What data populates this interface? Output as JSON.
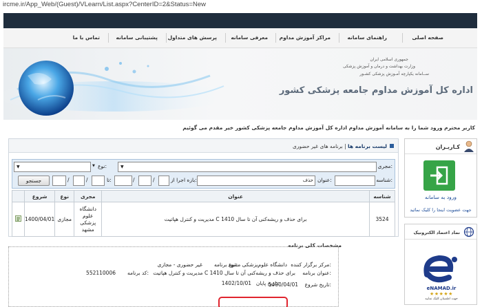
{
  "browser": {
    "url": "ircme.ir/App_Web/(Guest)/VLearn/List.aspx?CenterID=2&Status=New"
  },
  "nav": {
    "items": [
      "صفحه اصلی",
      "راهنمای سامانه",
      "مراکز آموزش مداوم",
      "معرفی سامانه",
      "پرسش های متداول",
      "پشتیبانی سامانه",
      "تماس با ما"
    ]
  },
  "banner": {
    "line1": "جمهوری اسلامی ایران",
    "line2": "وزارت بهداشت و درمان و آموزش پزشکی",
    "line3": "ســامانه یکپارچه آمـوزش پزشکی کشـور",
    "title": "اداره کل آموزش مداوم جامعه پزشکی کشور"
  },
  "welcome": "کاربر محترم ورود شما را به سامانه آموزش مداوم اداره کل آموزش مداوم جامعه پزشکی کشور خیر مقدم می گوئیم",
  "list_panel": {
    "title": "لیست برنامه ها",
    "subtitle": "| برنامه های غیر حضوری"
  },
  "filters": {
    "executor_label": "مجری:",
    "type_label": "نوع:",
    "id_label": "شناسه:",
    "title_label": "عنوان:",
    "title_value": "حذف",
    "date_range_label": "بازه اجرا از:",
    "to_label": "تا:",
    "slash": "/",
    "search_button": "جستجو"
  },
  "table": {
    "headers": [
      "شناسه",
      "عنوان",
      "مجری",
      "نوع",
      "شروع"
    ],
    "rows": [
      {
        "id": "3524",
        "title": "مدیریت و کنترل هپاتیت C برای حذف و ریشه‌کنی آن تا سال 1410",
        "executor": [
          "دانشگاه",
          "علوم",
          "پزشکی",
          "مشهد"
        ],
        "type": "مجازی",
        "start": "1400/04/01"
      }
    ]
  },
  "details": {
    "legend": "مشخصات کلی برنامه",
    "organizer_label": "مرکز برگزار کننده:",
    "organizer_value": "دانشگاه علوم‌پزشکی مشهد",
    "program_type_label": "نوع برنامه:",
    "program_type_value": "غیر حضوری - مجازی",
    "program_title_label": "عنوان برنامه:",
    "program_title_value": "مدیریت و کنترل هپاتیت C برای حذف و ریشه‌کنی آن تا سال 1410",
    "code_label": "کد برنامه:",
    "code_value": "552110006",
    "start_label": "تاریخ شروع:",
    "start_value": "1400/04/01",
    "end_label": "تاریخ پایان:",
    "end_value": "1402/10/01"
  },
  "users_box": {
    "title": "کـاربـران",
    "login_label": "ورود به سامانه",
    "register_link": "جهت عضویت اینجا را کلیک نمائید"
  },
  "enamad_box": {
    "title": "نماد اعتماد الکترونیک",
    "badge_text": "eNAMAD.ir",
    "badge_sub": "جهت اطمینان کلیک نمایید"
  },
  "colors": {
    "topbar": "#1f2d3d",
    "login_green": "#36a447",
    "highlight_red": "#e0242e",
    "enamad_blue": "#1e3b8a"
  }
}
